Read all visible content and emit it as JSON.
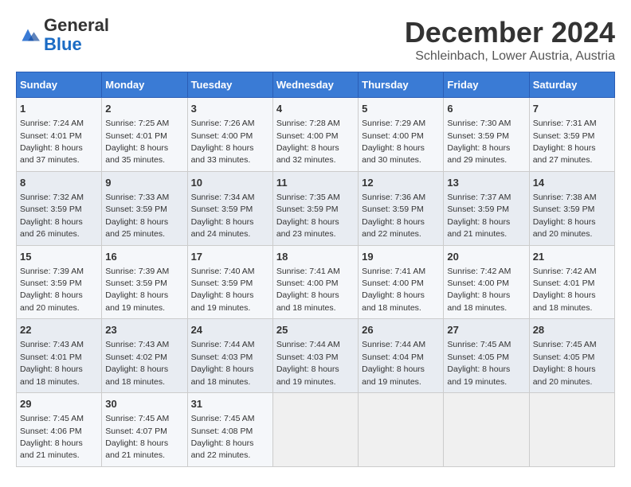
{
  "header": {
    "logo_line1": "General",
    "logo_line2": "Blue",
    "month_year": "December 2024",
    "location": "Schleinbach, Lower Austria, Austria"
  },
  "days_of_week": [
    "Sunday",
    "Monday",
    "Tuesday",
    "Wednesday",
    "Thursday",
    "Friday",
    "Saturday"
  ],
  "weeks": [
    [
      {
        "day": "1",
        "sunrise": "7:24 AM",
        "sunset": "4:01 PM",
        "daylight": "8 hours and 37 minutes."
      },
      {
        "day": "2",
        "sunrise": "7:25 AM",
        "sunset": "4:01 PM",
        "daylight": "8 hours and 35 minutes."
      },
      {
        "day": "3",
        "sunrise": "7:26 AM",
        "sunset": "4:00 PM",
        "daylight": "8 hours and 33 minutes."
      },
      {
        "day": "4",
        "sunrise": "7:28 AM",
        "sunset": "4:00 PM",
        "daylight": "8 hours and 32 minutes."
      },
      {
        "day": "5",
        "sunrise": "7:29 AM",
        "sunset": "4:00 PM",
        "daylight": "8 hours and 30 minutes."
      },
      {
        "day": "6",
        "sunrise": "7:30 AM",
        "sunset": "3:59 PM",
        "daylight": "8 hours and 29 minutes."
      },
      {
        "day": "7",
        "sunrise": "7:31 AM",
        "sunset": "3:59 PM",
        "daylight": "8 hours and 27 minutes."
      }
    ],
    [
      {
        "day": "8",
        "sunrise": "7:32 AM",
        "sunset": "3:59 PM",
        "daylight": "8 hours and 26 minutes."
      },
      {
        "day": "9",
        "sunrise": "7:33 AM",
        "sunset": "3:59 PM",
        "daylight": "8 hours and 25 minutes."
      },
      {
        "day": "10",
        "sunrise": "7:34 AM",
        "sunset": "3:59 PM",
        "daylight": "8 hours and 24 minutes."
      },
      {
        "day": "11",
        "sunrise": "7:35 AM",
        "sunset": "3:59 PM",
        "daylight": "8 hours and 23 minutes."
      },
      {
        "day": "12",
        "sunrise": "7:36 AM",
        "sunset": "3:59 PM",
        "daylight": "8 hours and 22 minutes."
      },
      {
        "day": "13",
        "sunrise": "7:37 AM",
        "sunset": "3:59 PM",
        "daylight": "8 hours and 21 minutes."
      },
      {
        "day": "14",
        "sunrise": "7:38 AM",
        "sunset": "3:59 PM",
        "daylight": "8 hours and 20 minutes."
      }
    ],
    [
      {
        "day": "15",
        "sunrise": "7:39 AM",
        "sunset": "3:59 PM",
        "daylight": "8 hours and 20 minutes."
      },
      {
        "day": "16",
        "sunrise": "7:39 AM",
        "sunset": "3:59 PM",
        "daylight": "8 hours and 19 minutes."
      },
      {
        "day": "17",
        "sunrise": "7:40 AM",
        "sunset": "3:59 PM",
        "daylight": "8 hours and 19 minutes."
      },
      {
        "day": "18",
        "sunrise": "7:41 AM",
        "sunset": "4:00 PM",
        "daylight": "8 hours and 18 minutes."
      },
      {
        "day": "19",
        "sunrise": "7:41 AM",
        "sunset": "4:00 PM",
        "daylight": "8 hours and 18 minutes."
      },
      {
        "day": "20",
        "sunrise": "7:42 AM",
        "sunset": "4:00 PM",
        "daylight": "8 hours and 18 minutes."
      },
      {
        "day": "21",
        "sunrise": "7:42 AM",
        "sunset": "4:01 PM",
        "daylight": "8 hours and 18 minutes."
      }
    ],
    [
      {
        "day": "22",
        "sunrise": "7:43 AM",
        "sunset": "4:01 PM",
        "daylight": "8 hours and 18 minutes."
      },
      {
        "day": "23",
        "sunrise": "7:43 AM",
        "sunset": "4:02 PM",
        "daylight": "8 hours and 18 minutes."
      },
      {
        "day": "24",
        "sunrise": "7:44 AM",
        "sunset": "4:03 PM",
        "daylight": "8 hours and 18 minutes."
      },
      {
        "day": "25",
        "sunrise": "7:44 AM",
        "sunset": "4:03 PM",
        "daylight": "8 hours and 19 minutes."
      },
      {
        "day": "26",
        "sunrise": "7:44 AM",
        "sunset": "4:04 PM",
        "daylight": "8 hours and 19 minutes."
      },
      {
        "day": "27",
        "sunrise": "7:45 AM",
        "sunset": "4:05 PM",
        "daylight": "8 hours and 19 minutes."
      },
      {
        "day": "28",
        "sunrise": "7:45 AM",
        "sunset": "4:05 PM",
        "daylight": "8 hours and 20 minutes."
      }
    ],
    [
      {
        "day": "29",
        "sunrise": "7:45 AM",
        "sunset": "4:06 PM",
        "daylight": "8 hours and 21 minutes."
      },
      {
        "day": "30",
        "sunrise": "7:45 AM",
        "sunset": "4:07 PM",
        "daylight": "8 hours and 21 minutes."
      },
      {
        "day": "31",
        "sunrise": "7:45 AM",
        "sunset": "4:08 PM",
        "daylight": "8 hours and 22 minutes."
      },
      null,
      null,
      null,
      null
    ]
  ]
}
